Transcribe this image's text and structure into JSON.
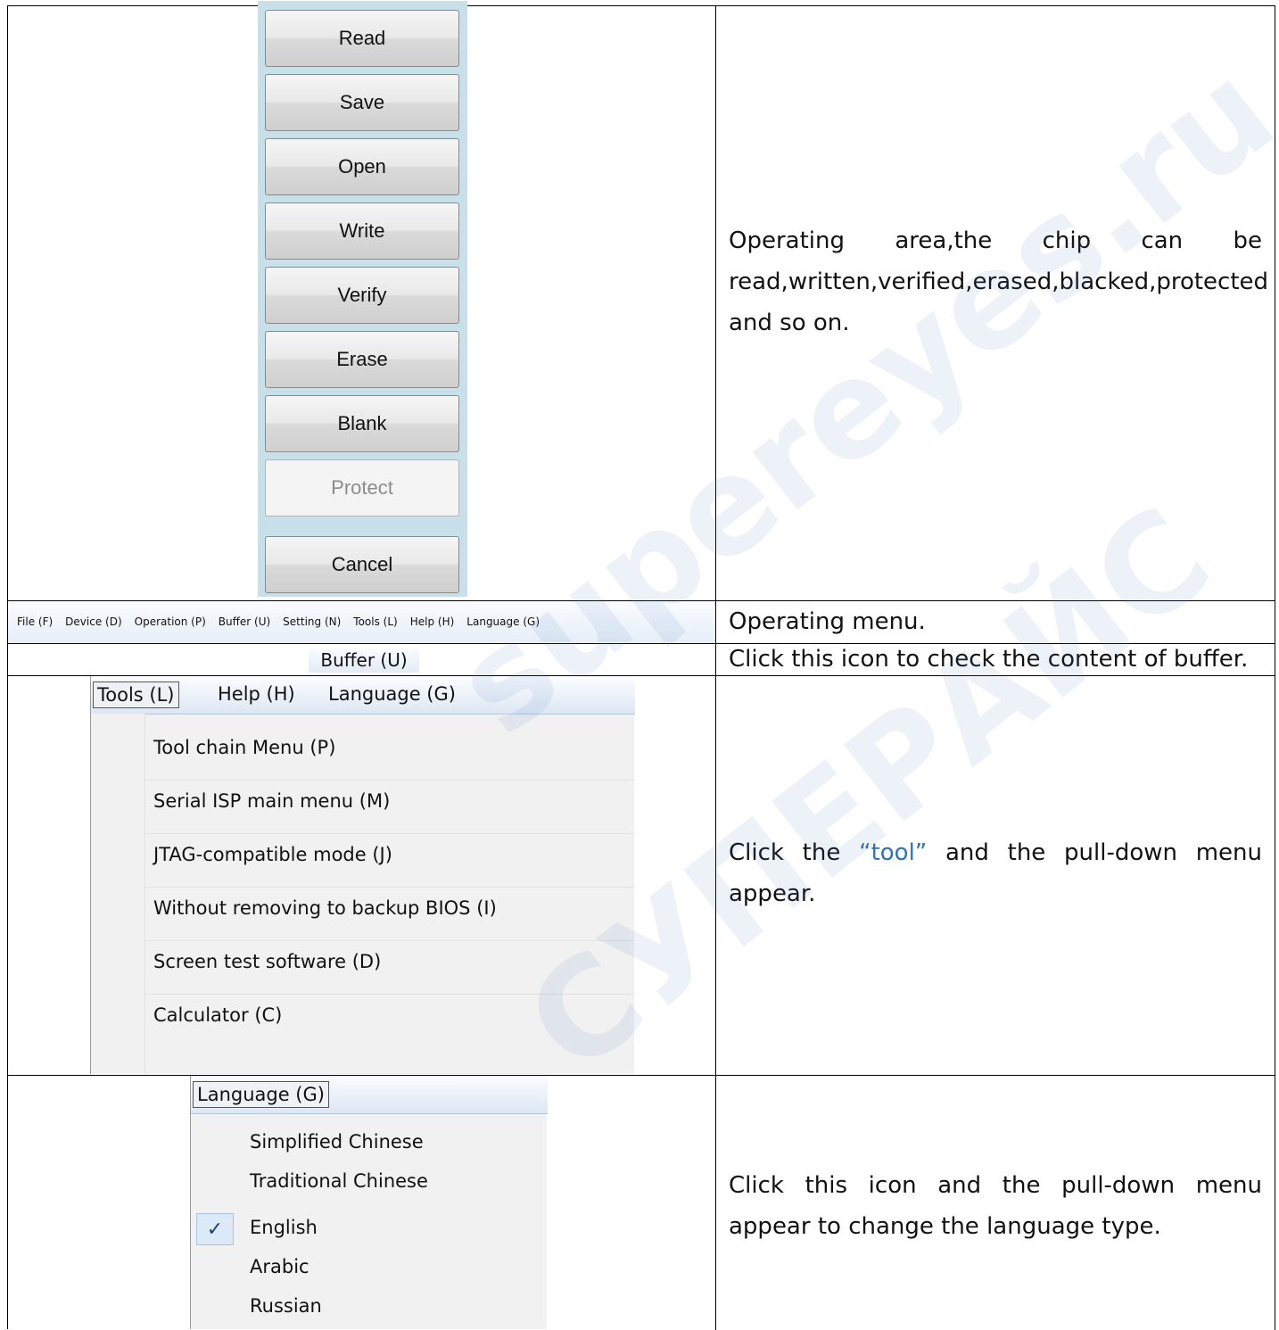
{
  "operating_buttons": [
    {
      "label": "Read",
      "enabled": true
    },
    {
      "label": "Save",
      "enabled": true
    },
    {
      "label": "Open",
      "enabled": true
    },
    {
      "label": "Write",
      "enabled": true
    },
    {
      "label": "Verify",
      "enabled": true
    },
    {
      "label": "Erase",
      "enabled": true
    },
    {
      "label": "Blank",
      "enabled": true
    },
    {
      "label": "Protect",
      "enabled": false
    },
    {
      "label": "Cancel",
      "enabled": true
    }
  ],
  "descriptions": {
    "operating_area": "Operating area,the chip can be read,written,verified,erased,blacked,protected and so on.",
    "operating_menu": "Operating menu.",
    "buffer": "Click this icon to check the content of buffer.",
    "tool_prefix": "Click the ",
    "tool_quote": "“tool”",
    "tool_suffix": " and the pull-down menu appear.",
    "language": "Click this icon and the pull-down menu appear to change the language type."
  },
  "menubar": {
    "items": [
      "File (F)",
      "Device (D)",
      "Operation (P)",
      "Buffer (U)",
      "Setting (N)",
      "Tools (L)",
      "Help (H)",
      "Language (G)"
    ]
  },
  "buffer_button": {
    "label": "Buffer (U)"
  },
  "tools_menu": {
    "header": [
      "Tools (L)",
      "Help (H)",
      "Language (G)"
    ],
    "items": [
      "Tool chain Menu (P)",
      "Serial ISP main menu (M)",
      "JTAG-compatible mode (J)",
      "Without removing to backup BIOS (I)",
      "Screen test software (D)",
      "Calculator (C)"
    ]
  },
  "language_menu": {
    "header": "Language (G)",
    "items": [
      "Simplified Chinese",
      "Traditional Chinese",
      "English",
      "Arabic",
      "Russian"
    ],
    "selected": "English",
    "check_mark": "✓"
  },
  "watermark": {
    "text1": "supereyes.ru",
    "text2": "СУПЕРАЙС"
  }
}
